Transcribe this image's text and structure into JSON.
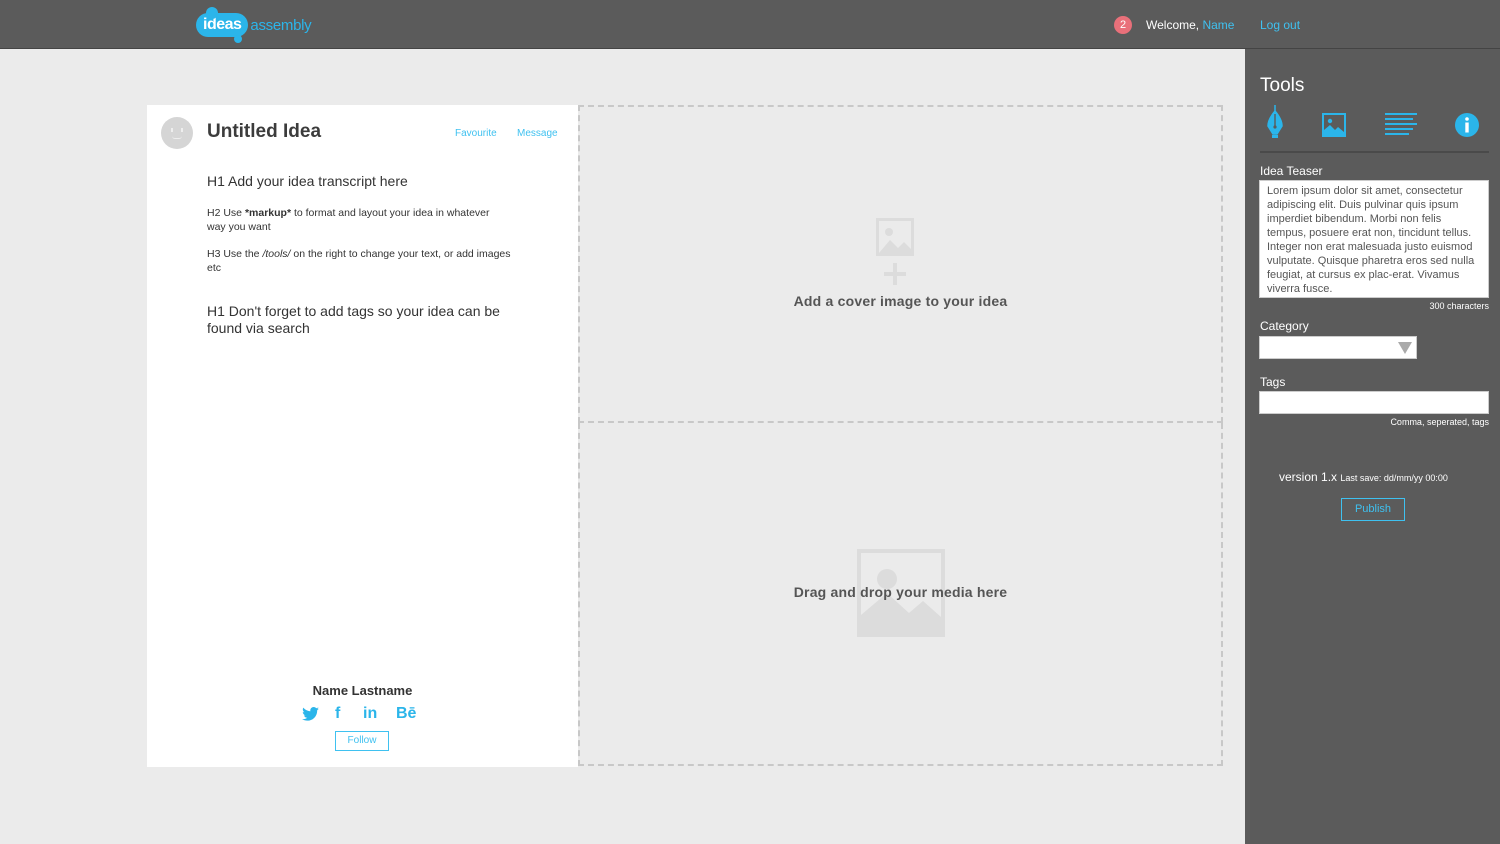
{
  "header": {
    "logo_part1": "ideas",
    "logo_part2": "assembly",
    "notification_count": "2",
    "welcome_prefix": "Welcome, ",
    "user_name": "Name",
    "logout": "Log out"
  },
  "idea": {
    "title": "Untitled Idea",
    "favourite": "Favourite",
    "message": "Message",
    "h1_line": "H1 Add your idea transcript here",
    "h2_prefix": "H2 Use ",
    "h2_bold": "*markup*",
    "h2_suffix": " to format and layout your idea in whatever way you want",
    "h3_prefix": "H3 Use the ",
    "h3_italic": "/tools/",
    "h3_suffix": " on the right to change your text, or add images etc",
    "h1b_line": "H1 Don't forget to add tags so your idea can be found via search",
    "author_name": "Name Lastname",
    "socials": {
      "twitter": "twitter-icon",
      "facebook": "f",
      "linkedin": "in",
      "behance": "Bē"
    },
    "follow": "Follow"
  },
  "media": {
    "cover_prompt": "Add a cover image to your idea",
    "drop_prompt": "Drag and drop your media here"
  },
  "tools": {
    "title": "Tools",
    "icons": [
      "pen-icon",
      "image-icon",
      "text-align-icon",
      "info-icon"
    ],
    "teaser_label": "Idea Teaser",
    "teaser_text": "Lorem ipsum dolor sit amet, consectetur adipiscing elit. Duis pulvinar quis ipsum imperdiet bibendum. Morbi non felis tempus, posuere erat non, tincidunt tellus. Integer non erat malesuada justo euismod vulputate. Quisque pharetra eros sed nulla feugiat, at cursus ex plac-erat. Vivamus viverra fusce.",
    "teaser_hint": "300 characters",
    "category_label": "Category",
    "category_value": "",
    "tags_label": "Tags",
    "tags_value": "",
    "tags_hint": "Comma, seperated, tags",
    "version": "version 1.x",
    "last_save": "Last save: dd/mm/yy   00:00",
    "publish": "Publish"
  },
  "colors": {
    "accent": "#2bb5ea",
    "topbar": "#5b5b5b",
    "notification": "#e9707a"
  }
}
